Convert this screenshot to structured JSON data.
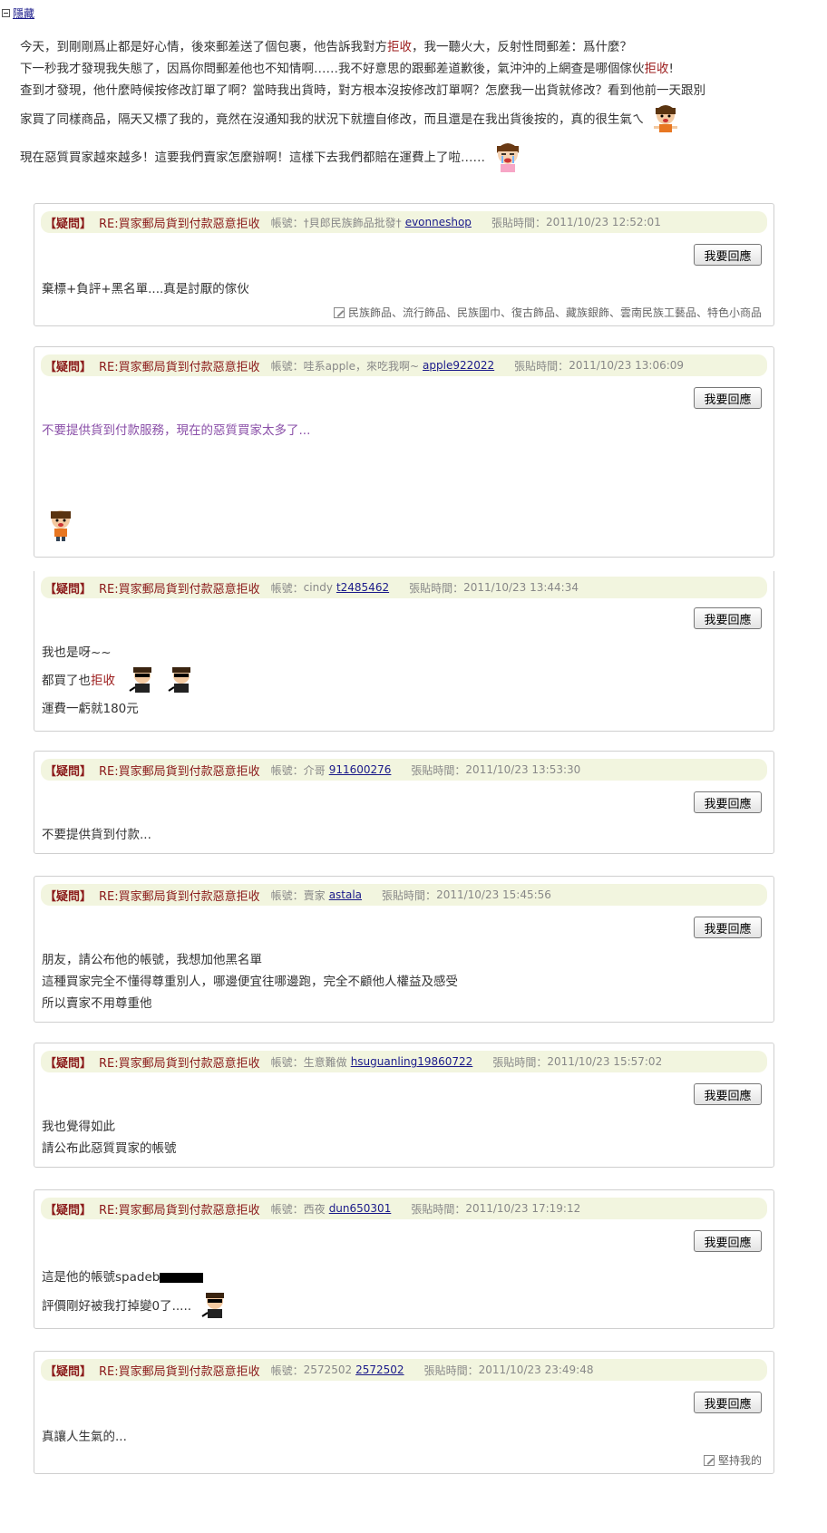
{
  "hide_link": "隱藏",
  "intro": {
    "lines": [
      [
        {
          "t": "今天，到剛剛爲止都是好心情，後來郵差送了個包裹，他告訴我對方"
        },
        {
          "t": "拒收",
          "red": true
        },
        {
          "t": "，我一聽火大，反射性問郵差：爲什麼？"
        }
      ],
      [
        {
          "t": "下一秒我才發現我失態了，因爲你問郵差他也不知情啊……我不好意思的跟郵差道歉後，氣沖沖的上網查是哪個傢伙"
        },
        {
          "t": "拒收",
          "red": true
        },
        {
          "t": "!"
        }
      ],
      [
        {
          "t": "查到才發現，他什麼時候按修改訂單了啊？當時我出貨時，對方根本沒按修改訂單啊？怎麼我一出貨就修改？看到他前一天跟別"
        }
      ],
      [
        {
          "t": "家買了同樣商品，隔天又標了我的，竟然在沒通知我的狀況下就擅自修改，而且還是在我出貨後按的，真的很生氣ㄟ"
        }
      ],
      [
        {
          "t": "現在惡質買家越來越多！這要我們賣家怎麼辦啊！這樣下去我們都賠在運費上了啦……"
        }
      ]
    ]
  },
  "common": {
    "tag": "【疑問】",
    "title": "RE:買家郵局貨到付款惡意拒收",
    "acct_label": "帳號：",
    "time_label": "張貼時間：",
    "reply_label": "我要回應"
  },
  "posts": [
    {
      "nick": "†貝郎民族飾品批發†",
      "user": "evonneshop",
      "time": "2011/10/23 12:52:01",
      "lines": [
        [
          {
            "t": "棄標+負評+黑名單....真是討厭的傢伙"
          }
        ]
      ],
      "tags": "民族飾品、流行飾品、民族圍巾、復古飾品、藏族銀飾、雲南民族工藝品、特色小商品"
    },
    {
      "nick": "哇系apple，來吃我啊~",
      "user": "apple922022",
      "time": "2011/10/23 13:06:09",
      "lines": [
        [
          {
            "t": "不要提供貨到付款服務，現在的惡質買家太多了...",
            "purple": true
          }
        ]
      ]
    },
    {
      "nick": "cindy",
      "user": "t2485462",
      "time": "2011/10/23 13:44:34",
      "lines": [
        [
          {
            "t": "我也是呀~~"
          }
        ],
        [
          {
            "t": "都買了也"
          },
          {
            "t": "拒收",
            "red": true
          }
        ],
        [
          {
            "t": "運費一虧就180元"
          }
        ]
      ]
    },
    {
      "nick": "介哥",
      "user": "911600276",
      "time": "2011/10/23 13:53:30",
      "lines": [
        [
          {
            "t": "不要提供貨到付款..."
          }
        ]
      ]
    },
    {
      "nick": "賣家",
      "user": "astala",
      "time": "2011/10/23 15:45:56",
      "lines": [
        [
          {
            "t": "朋友，請公布他的帳號，我想加他黑名單"
          }
        ],
        [
          {
            "t": "這種買家完全不懂得尊重別人，哪邊便宜往哪邊跑，完全不顧他人權益及感受"
          }
        ],
        [
          {
            "t": "所以賣家不用尊重他"
          }
        ]
      ]
    },
    {
      "nick": "生意難做",
      "user": "hsuguanling19860722",
      "time": "2011/10/23 15:57:02",
      "lines": [
        [
          {
            "t": "我也覺得如此"
          }
        ],
        [
          {
            "t": "請公布此惡質買家的帳號"
          }
        ]
      ]
    },
    {
      "nick": "西夜",
      "user": "dun650301",
      "time": "2011/10/23 17:19:12",
      "lines": [
        [
          {
            "t": "這是他的帳號spadeb"
          }
        ],
        [
          {
            "t": "評價剛好被我打掉變0了....."
          }
        ]
      ]
    },
    {
      "nick": "2572502",
      "user": "2572502",
      "time": "2011/10/23 23:49:48",
      "lines": [
        [
          {
            "t": "真讓人生氣的..."
          }
        ]
      ],
      "tags": "堅持我的"
    }
  ]
}
